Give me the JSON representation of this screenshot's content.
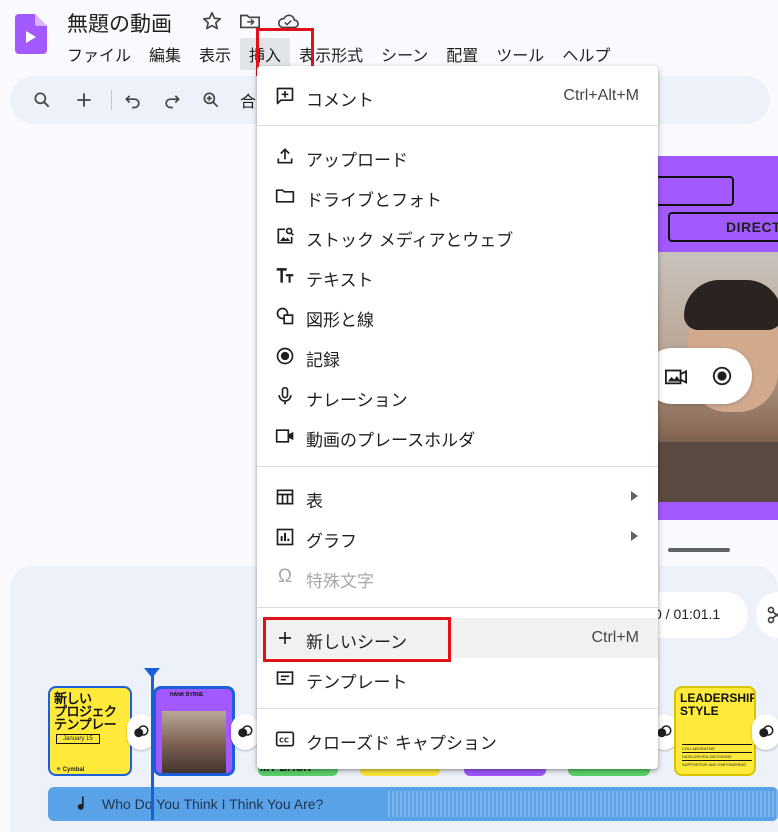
{
  "app": {
    "title": "無題の動画",
    "brand_color": "#a259ff",
    "accent_color": "#1a5ed8",
    "highlight_color": "#e3101a"
  },
  "menubar": [
    {
      "label": "ファイル"
    },
    {
      "label": "編集"
    },
    {
      "label": "表示"
    },
    {
      "label": "挿入"
    },
    {
      "label": "表示形式"
    },
    {
      "label": "シーン"
    },
    {
      "label": "配置"
    },
    {
      "label": "ツール"
    },
    {
      "label": "ヘルプ"
    }
  ],
  "toolbar": {
    "icons": [
      "search-icon",
      "add-icon",
      "undo-icon",
      "redo-icon",
      "zoom-icon"
    ],
    "partial_label": "合"
  },
  "insert_menu": {
    "items": [
      {
        "label": "コメント",
        "shortcut": "Ctrl+Alt+M",
        "icon": "comment-icon"
      },
      {
        "label": "アップロード",
        "icon": "upload-icon"
      },
      {
        "label": "ドライブとフォト",
        "icon": "folder-icon"
      },
      {
        "label": "ストック メディアとウェブ",
        "icon": "image-search-icon"
      },
      {
        "label": "テキスト",
        "icon": "text-icon"
      },
      {
        "label": "図形と線",
        "icon": "shapes-icon"
      },
      {
        "label": "記録",
        "icon": "record-icon"
      },
      {
        "label": "ナレーション",
        "icon": "microphone-icon"
      },
      {
        "label": "動画のプレースホルダ",
        "icon": "video-placeholder-icon"
      },
      {
        "label": "表",
        "icon": "table-icon",
        "submenu": true
      },
      {
        "label": "グラフ",
        "icon": "chart-icon",
        "submenu": true
      },
      {
        "label": "特殊文字",
        "icon": "omega-icon",
        "disabled": true
      },
      {
        "label": "新しいシーン",
        "shortcut": "Ctrl+M",
        "icon": "plus-icon"
      },
      {
        "label": "テンプレート",
        "icon": "template-icon"
      },
      {
        "label": "クローズド キャプション",
        "icon": "closed-caption-icon"
      }
    ]
  },
  "canvas": {
    "slide_heading": "DIRECT"
  },
  "timeline": {
    "current_time": "0",
    "separator": " / ",
    "total_time": "01:01.1",
    "scenes": {
      "first": {
        "title_lines": [
          "新しい",
          "プロジェク",
          "テンプレー"
        ],
        "badge": "January 15",
        "brand": "✳ Cymbal"
      },
      "second": {
        "header": "HANK BYRNE"
      },
      "hidden_label": "MY BACK",
      "last": {
        "title": "LEADERSHIP STYLE",
        "list": [
          "COLLABORATIVE",
          "DATA-DRIVEN DECISIONS",
          "SUPPORTIVE AND EMPOWERING"
        ]
      }
    },
    "audio_track": "Who Do You Think I Think You Are?"
  }
}
